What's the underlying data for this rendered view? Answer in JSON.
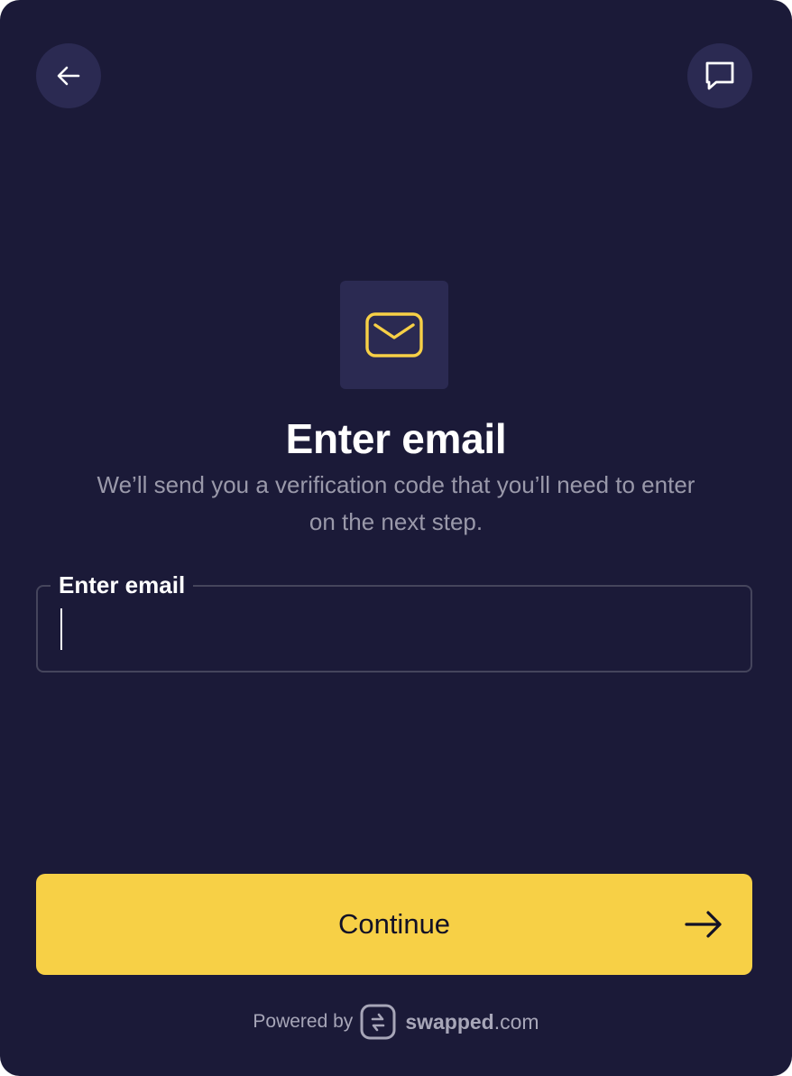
{
  "header": {
    "back_icon": "arrow-left-icon",
    "support_icon": "chat-bubble-icon"
  },
  "hero": {
    "icon": "envelope-icon",
    "title": "Enter email",
    "subtitle": "We’ll send you a verification code that you’ll need to enter on the next step."
  },
  "email_field": {
    "label": "Enter email",
    "value": "",
    "placeholder": ""
  },
  "continue_button": {
    "label": "Continue",
    "icon": "arrow-right-icon"
  },
  "footer": {
    "powered_by": "Powered by",
    "brand_name": "swapped",
    "brand_tld": ".com",
    "logo_icon": "swapped-logo-icon"
  },
  "colors": {
    "background": "#1b1a38",
    "surface": "#2b2a52",
    "accent": "#f7d046",
    "muted_text": "#9a99aa",
    "field_border": "#45455c"
  }
}
